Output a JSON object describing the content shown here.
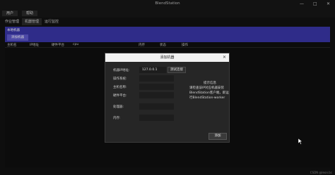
{
  "window": {
    "title": "BlendStation",
    "minimize": "—",
    "maximize": "□",
    "close": "✕"
  },
  "menu": {
    "items": [
      "用户",
      "帮助"
    ]
  },
  "tabs": [
    "作业管理",
    "机器管理",
    "运行监控"
  ],
  "panel": {
    "title": "本地机器",
    "add_button": "添加机器",
    "columns": [
      "主机名",
      "IP地址",
      "硬件平台",
      "cpu",
      "内存",
      "状态",
      "操作"
    ]
  },
  "dialog": {
    "title": "添加机器",
    "close": "✕",
    "fields": [
      {
        "label": "机器IP地址:",
        "value": "127.0.0.1"
      },
      {
        "label": "操作系统:",
        "value": ""
      },
      {
        "label": "主机名称:",
        "value": ""
      },
      {
        "label": "硬件平台:",
        "value": ""
      },
      {
        "label": "处理器:",
        "value": ""
      },
      {
        "label": "内存:",
        "value": ""
      }
    ],
    "test_button": "测试连接",
    "tip": {
      "title": "提示信息",
      "lines": [
        "请检查该IP对应机器安装",
        "BlendStation客户端，即运",
        "行BlendStation-worker"
      ]
    },
    "confirm_button": "添加"
  },
  "watermark": "CSDN @leon.bc"
}
